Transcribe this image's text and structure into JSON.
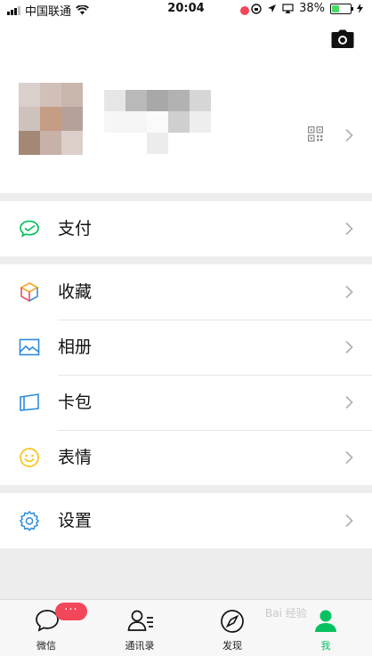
{
  "status_bar": {
    "carrier": "中国联通",
    "time": "20:04",
    "battery": "38%",
    "battery_level": 0.38
  },
  "profile": {
    "camera_icon": "camera-icon",
    "qr_icon": "qr-code-icon",
    "avatar_pixels": [
      "#d9cfcd",
      "#d0c0b8",
      "#c9b6ad",
      "#cfc2bc",
      "#c59c84",
      "#b6a19a",
      "#a48775",
      "#c8b2a8",
      "#dccfc9"
    ],
    "nickname_pixels": [
      "#e6e6e6",
      "#b9b9b9",
      "#a8a8a8",
      "#b2b2b2",
      "#d6d6d6",
      "#f6f6f6",
      "#f5f5f5",
      "#fafafa",
      "#cfcfcf",
      "#eeeeee",
      "#ffffff",
      "#ffffff",
      "#ececec",
      "#ffffff",
      "#ffffff"
    ]
  },
  "menu": [
    {
      "label": "支付",
      "icon": "wallet-icon"
    },
    {
      "label": "收藏",
      "icon": "cube-icon"
    },
    {
      "label": "相册",
      "icon": "photo-album-icon"
    },
    {
      "label": "卡包",
      "icon": "card-wallet-icon"
    },
    {
      "label": "表情",
      "icon": "smiley-icon"
    },
    {
      "label": "设置",
      "icon": "gear-icon"
    }
  ],
  "tabbar": {
    "tabs": [
      {
        "label": "微信",
        "icon": "chat-icon"
      },
      {
        "label": "通讯录",
        "icon": "contacts-icon"
      },
      {
        "label": "发现",
        "icon": "compass-icon"
      },
      {
        "label": "我",
        "icon": "me-icon"
      }
    ],
    "chat_badge": "···",
    "watermark": "Bai 经验"
  },
  "colors": {
    "accent": "#07c160",
    "badge": "#f2465a",
    "background": "#ededed"
  }
}
